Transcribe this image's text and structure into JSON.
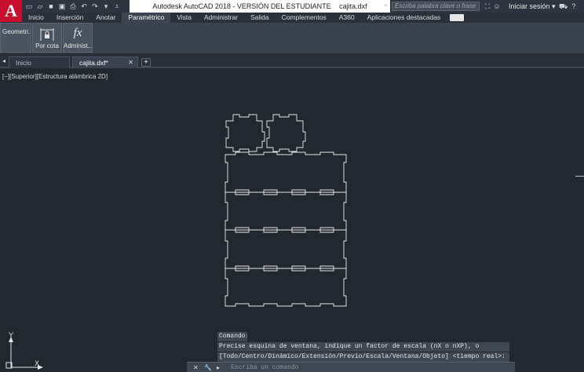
{
  "app": {
    "logo_letter": "A",
    "title": "Autodesk AutoCAD 2018 - VERSIÓN DEL ESTUDIANTE",
    "file": "cajita.dxf",
    "search_placeholder": "Escriba palabra clave o frase",
    "signin": "Iniciar sesión"
  },
  "qat_icons": [
    "new-file-icon",
    "open-file-icon",
    "save-icon",
    "save-as-icon",
    "print-icon",
    "undo-icon",
    "redo-icon",
    "share-icon",
    "customize-icon"
  ],
  "menu": {
    "items": [
      "Inicio",
      "Inserción",
      "Anotar",
      "Paramétrico",
      "Vista",
      "Administrar",
      "Salida",
      "Complementos",
      "A360",
      "Aplicaciones destacadas"
    ],
    "active": "Paramétrico"
  },
  "ribbon": {
    "geometric": "Geometri...",
    "by_dimension": "Por cota",
    "manage": "Administ...",
    "fx_glyph": "fx"
  },
  "tabs": {
    "home": "Inicio",
    "file": "cajita.dxf*",
    "add": "+"
  },
  "viewport": {
    "label": "[−][Superior][Estructura alámbrica 2D]"
  },
  "ucs": {
    "y": "Y",
    "x": "X"
  },
  "command": {
    "history": [
      "Comando:",
      "Precise esquina de ventana, indique un factor de escala (nX o nXP), o",
      "[Todo/Centro/Dinámico/Extensión/Previo/Escala/Ventana/Objeto] <tiempo real>:"
    ],
    "placeholder": "Escriba un comando"
  }
}
